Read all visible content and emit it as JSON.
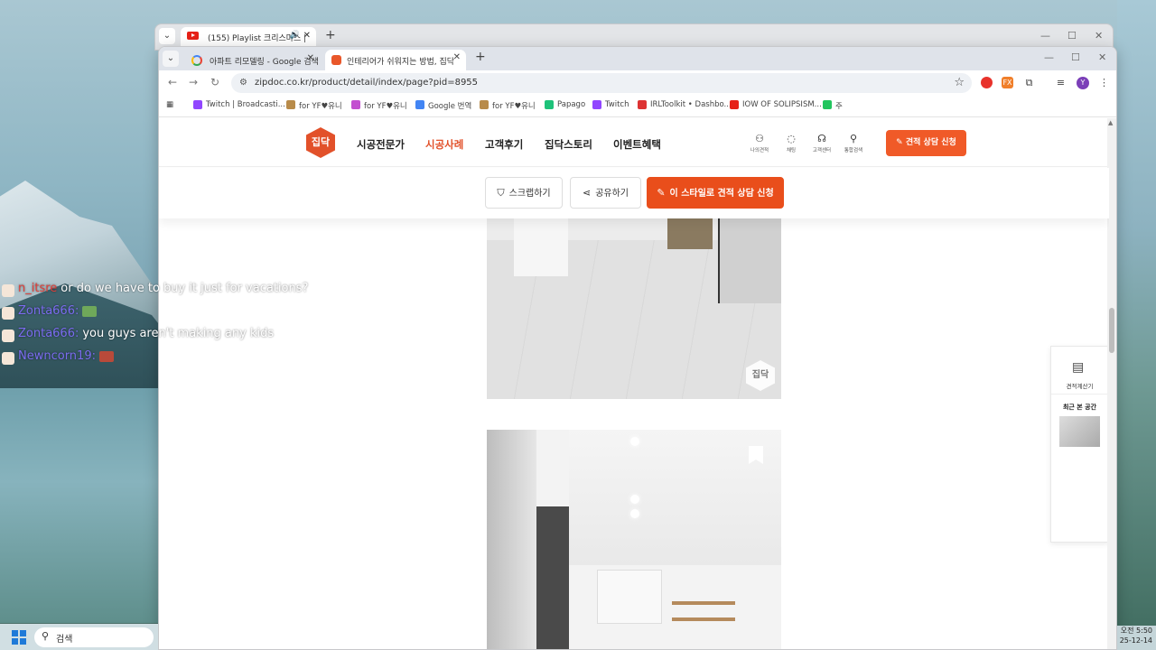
{
  "back_window": {
    "tab_title": "(155) Playlist 크리스마스 |"
  },
  "browser": {
    "tabs": [
      {
        "title": "아파트 리모델링 - Google 검색"
      },
      {
        "title": "인테리어가 쉬워지는 방법, 집닥"
      }
    ],
    "url": "zipdoc.co.kr/product/detail/index/page?pid=8955",
    "bookmarks": [
      {
        "label": "Twitch | Broadcasti..."
      },
      {
        "label": "for YF♥유니"
      },
      {
        "label": "for YF♥유니"
      },
      {
        "label": "Google 번역"
      },
      {
        "label": "for YF♥유니"
      },
      {
        "label": "Papago"
      },
      {
        "label": "Twitch"
      },
      {
        "label": "IRLToolkit • Dashbo..."
      },
      {
        "label": "IOW OF SOLIPSISM..."
      },
      {
        "label": "주"
      }
    ],
    "avatar_letter": "Y"
  },
  "site": {
    "logo": "집닥",
    "nav": [
      "시공전문가",
      "시공사례",
      "고객후기",
      "집닥스토리",
      "이벤트혜택"
    ],
    "active_nav": "시공사례",
    "utils": [
      "나의견적",
      "채팅",
      "고객센터",
      "통합검색"
    ],
    "cta_top": "견적 상담 신청",
    "accent": "#e94e1b"
  },
  "actions": {
    "scrap": "스크랩하기",
    "share": "공유하기",
    "consult": "이 스타일로 견적 상담 신청"
  },
  "watermark": "집닥",
  "side_widget": {
    "calculator": "견적계산기",
    "recent": "최근 본 공간"
  },
  "chat": [
    {
      "user": "n_itsre",
      "user_color": "#e0403a",
      "message": "or do we have to buy it just for vacations?"
    },
    {
      "user": "Zonta666:",
      "user_color": "#7b6cf0",
      "message": ""
    },
    {
      "user": "Zonta666:",
      "user_color": "#7b6cf0",
      "message": "you guys aren't making any kids"
    },
    {
      "user": "Newncorn19:",
      "user_color": "#7b6cf0",
      "message": ""
    }
  ],
  "taskbar": {
    "search": "검색",
    "time": "오전 5:50",
    "date": "25-12-14"
  }
}
